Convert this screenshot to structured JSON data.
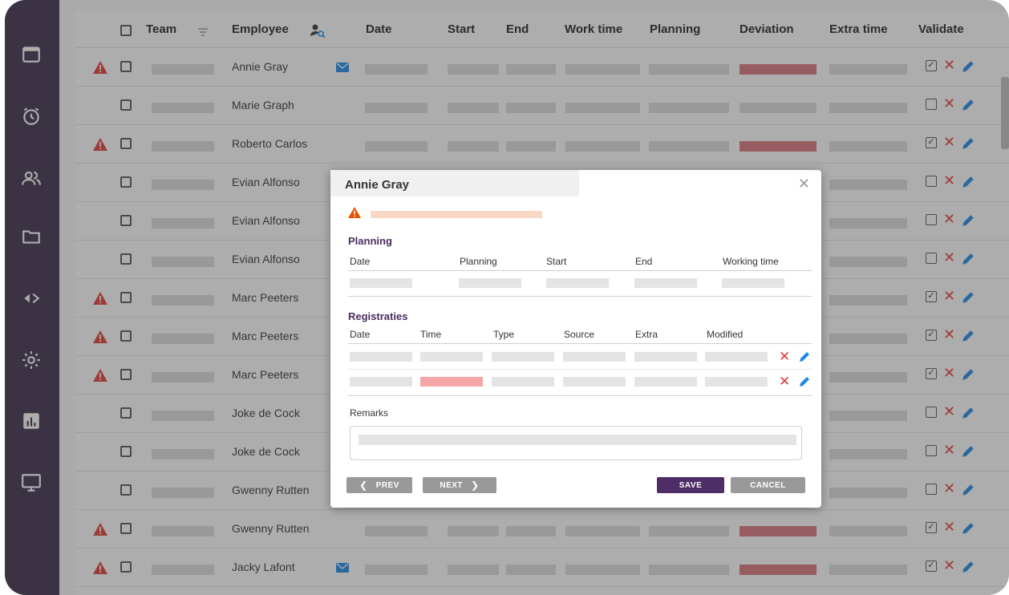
{
  "table": {
    "headers": {
      "team": "Team",
      "employee": "Employee",
      "date": "Date",
      "start": "Start",
      "end": "End",
      "work_time": "Work time",
      "planning": "Planning",
      "deviation": "Deviation",
      "extra_time": "Extra time",
      "validate": "Validate"
    },
    "rows": [
      {
        "employee": "Annie Gray",
        "warning": true,
        "mail": true,
        "deviation_flag": true,
        "validated": true
      },
      {
        "employee": "Marie Graph",
        "warning": false,
        "mail": false,
        "deviation_flag": false,
        "validated": false
      },
      {
        "employee": "Roberto Carlos",
        "warning": true,
        "mail": false,
        "deviation_flag": true,
        "validated": true
      },
      {
        "employee": "Evian Alfonso",
        "warning": false,
        "mail": false,
        "deviation_flag": false,
        "validated": false
      },
      {
        "employee": "Evian Alfonso",
        "warning": false,
        "mail": false,
        "deviation_flag": false,
        "validated": false
      },
      {
        "employee": "Evian Alfonso",
        "warning": false,
        "mail": false,
        "deviation_flag": false,
        "validated": false
      },
      {
        "employee": "Marc Peeters",
        "warning": true,
        "mail": false,
        "deviation_flag": false,
        "validated": true
      },
      {
        "employee": "Marc Peeters",
        "warning": true,
        "mail": false,
        "deviation_flag": false,
        "validated": true
      },
      {
        "employee": "Marc Peeters",
        "warning": true,
        "mail": false,
        "deviation_flag": false,
        "validated": true
      },
      {
        "employee": "Joke de Cock",
        "warning": false,
        "mail": false,
        "deviation_flag": false,
        "validated": false
      },
      {
        "employee": "Joke de Cock",
        "warning": false,
        "mail": false,
        "deviation_flag": false,
        "validated": false
      },
      {
        "employee": "Gwenny Rutten",
        "warning": false,
        "mail": false,
        "deviation_flag": false,
        "validated": false
      },
      {
        "employee": "Gwenny Rutten",
        "warning": true,
        "mail": false,
        "deviation_flag": true,
        "validated": true
      },
      {
        "employee": "Jacky Lafont",
        "warning": true,
        "mail": true,
        "deviation_flag": true,
        "validated": true
      }
    ]
  },
  "sidebar": {
    "icons": [
      "calendar-icon",
      "alarm-clock-icon",
      "users-icon",
      "folder-icon",
      "code-arrows-icon",
      "gear-icon",
      "bar-chart-icon",
      "monitor-icon"
    ]
  },
  "modal": {
    "title": "Annie Gray",
    "planning_section": {
      "title": "Planning",
      "columns": [
        "Date",
        "Planning",
        "Start",
        "End",
        "Working time"
      ]
    },
    "registraties_section": {
      "title": "Registraties",
      "columns": [
        "Date",
        "Time",
        "Type",
        "Source",
        "Extra",
        "Modified"
      ]
    },
    "remarks_label": "Remarks",
    "buttons": {
      "prev": "PREV",
      "next": "NEXT",
      "save": "SAVE",
      "cancel": "CANCEL"
    }
  },
  "colors": {
    "sidebar": "#3b2c4b",
    "accent": "#4f2d66",
    "warning": "#e65100",
    "danger": "#e53935",
    "link": "#1e88e5"
  }
}
